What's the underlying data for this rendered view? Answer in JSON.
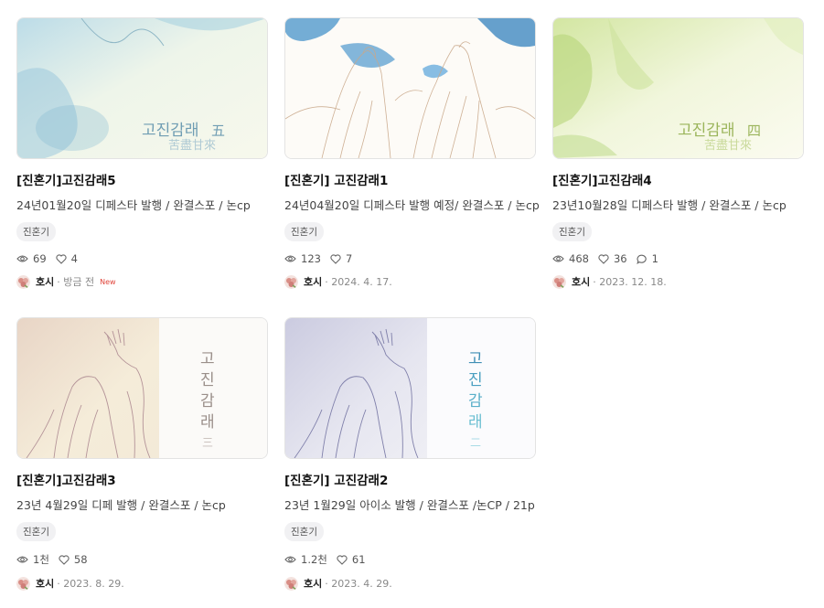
{
  "cards": [
    {
      "title": "[진혼기]고진감래5",
      "desc": "24년01월20일 디페스타 발행 / 완결스포 / 논cp",
      "tag": "진혼기",
      "views": "69",
      "likes": "4",
      "comments": null,
      "author": "호시",
      "date": "· 방금 전",
      "new_badge": "New",
      "cover_text_hangul": "고진감래",
      "cover_text_hanja": "五",
      "cover_text_sub": "苦盡甘來",
      "palette": [
        "#cfe6ee",
        "#f4f6e8",
        "#7fb7cf"
      ]
    },
    {
      "title": "[진혼기] 고진감래1",
      "desc": "24년04월20일 디페스타 발행 예정/ 완결스포 / 논cp",
      "tag": "진혼기",
      "views": "123",
      "likes": "7",
      "comments": null,
      "author": "호시",
      "date": "· 2024. 4. 17.",
      "new_badge": null,
      "palette": [
        "#fdfbf7",
        "#e9d9c6",
        "#4b8fc4"
      ]
    },
    {
      "title": "[진혼기]고진감래4",
      "desc": "23년10월28일 디페스타 발행 / 완결스포 / 논cp",
      "tag": "진혼기",
      "views": "468",
      "likes": "36",
      "comments": "1",
      "author": "호시",
      "date": "· 2023. 12. 18.",
      "new_badge": null,
      "cover_text_hangul": "고진감래",
      "cover_text_hanja": "四",
      "cover_text_sub": "苦盡甘來",
      "palette": [
        "#e4efc0",
        "#fbfbf0",
        "#a9c86a"
      ]
    },
    {
      "title": "[진혼기]고진감래3",
      "desc": "23년 4월29일 디페 발행 / 완결스포 / 논cp",
      "tag": "진혼기",
      "views": "1천",
      "likes": "58",
      "comments": null,
      "author": "호시",
      "date": "· 2023. 8. 29.",
      "new_badge": null,
      "cover_text_vertical": "고진감래",
      "cover_text_num": "三",
      "palette": [
        "#efe0c8",
        "#fbfaf6",
        "#b9868f"
      ]
    },
    {
      "title": "[진혼기] 고진감래2",
      "desc": "23년 1월29일 아이소 발행 / 완결스포 /논CP / 21p",
      "tag": "진혼기",
      "views": "1.2천",
      "likes": "61",
      "comments": null,
      "author": "호시",
      "date": "· 2023. 4. 29.",
      "new_badge": null,
      "cover_text_vertical": "고진감래",
      "cover_text_num": "二",
      "palette": [
        "#d3d3e6",
        "#fbfbfd",
        "#4a9fc1"
      ]
    }
  ]
}
